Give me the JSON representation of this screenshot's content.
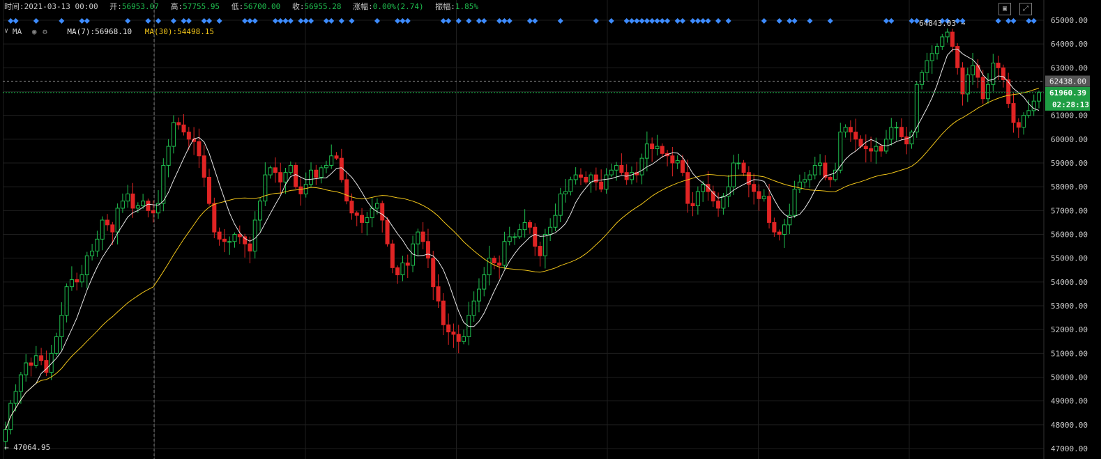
{
  "header": {
    "time_label": "时间:",
    "time_value": "2021-03-13 00:00",
    "open_label": "开:",
    "open_value": "56953.07",
    "high_label": "高:",
    "high_value": "57755.95",
    "low_label": "低:",
    "low_value": "56700.00",
    "close_label": "收:",
    "close_value": "56955.28",
    "change_label": "涨幅:",
    "change_value": "0.00%(2.74)",
    "amplitude_label": "振幅:",
    "amplitude_value": "1.85%"
  },
  "indicator": {
    "name": "MA",
    "ma7_text": "MA(7):56968.10",
    "ma30_text": "MA(30):54498.15"
  },
  "colors": {
    "up": "#1fbf4f",
    "down": "#e02424",
    "ma7": "#e6e6e6",
    "ma30": "#f0c419",
    "marker": "#3d8bfd",
    "grid": "#1e1e1e"
  },
  "icons": [
    "chevron-down-icon",
    "eye-icon",
    "gear-icon",
    "save-image-icon",
    "expand-icon"
  ],
  "chart_data": {
    "type": "candlestick",
    "y_axis_ticks": [
      "65000.00",
      "64000.00",
      "63000.00",
      "62000.00",
      "61000.00",
      "60000.00",
      "59000.00",
      "58000.00",
      "57000.00",
      "56000.00",
      "55000.00",
      "54000.00",
      "53000.00",
      "52000.00",
      "51000.00",
      "50000.00",
      "49000.00",
      "48000.00",
      "47000.00"
    ],
    "ylim": [
      46900,
      65300
    ],
    "grid": true,
    "max_label": "64843.03",
    "min_label": "47064.95",
    "current_price_label": "61960.39",
    "current_price": 61960.39,
    "dashed_price_label": "62438.00",
    "dashed_price": 62438.0,
    "countdown_label": "02:28:13",
    "closes": [
      47800,
      48900,
      49400,
      50100,
      50600,
      50500,
      50900,
      50700,
      50200,
      51000,
      51700,
      52600,
      53800,
      54100,
      54000,
      54300,
      55100,
      55300,
      55800,
      56600,
      56400,
      56100,
      57100,
      57400,
      57700,
      57100,
      57200,
      57400,
      57000,
      56900,
      57300,
      58900,
      59700,
      60700,
      60600,
      60300,
      60000,
      59900,
      59300,
      58400,
      57300,
      56100,
      55800,
      55700,
      55700,
      56000,
      55900,
      55600,
      55300,
      56600,
      57400,
      58500,
      58800,
      58600,
      58200,
      58600,
      58900,
      58000,
      57700,
      58100,
      58700,
      58400,
      58800,
      58900,
      59300,
      59200,
      58300,
      57400,
      56900,
      56800,
      56500,
      56700,
      57100,
      57300,
      56600,
      55600,
      54600,
      54300,
      54800,
      54700,
      55600,
      56100,
      55700,
      55000,
      53800,
      53200,
      52200,
      51900,
      51800,
      51500,
      51700,
      52600,
      53200,
      53700,
      54300,
      55000,
      54800,
      54700,
      55700,
      55900,
      55900,
      56200,
      56500,
      56300,
      55500,
      55100,
      56000,
      56300,
      56800,
      57700,
      57800,
      58300,
      58500,
      58400,
      58200,
      58500,
      58200,
      57900,
      58500,
      58700,
      58900,
      58600,
      58300,
      58600,
      58500,
      59200,
      59800,
      59600,
      59700,
      59400,
      59300,
      59000,
      59100,
      58600,
      57300,
      57200,
      57800,
      58100,
      57800,
      57400,
      57100,
      57600,
      58000,
      59000,
      59000,
      58600,
      58100,
      57800,
      57500,
      57600,
      56500,
      56100,
      56000,
      56400,
      56800,
      57900,
      58200,
      58300,
      58500,
      58900,
      59000,
      58400,
      58300,
      58700,
      60300,
      60500,
      60300,
      60000,
      59700,
      59600,
      59500,
      59700,
      59500,
      60000,
      60500,
      60500,
      60100,
      59800,
      60300,
      62300,
      62800,
      63300,
      63600,
      63900,
      64300,
      64500,
      63900,
      63000,
      61900,
      62700,
      63100,
      62600,
      61700,
      62300,
      63200,
      63000,
      62500,
      61500,
      60700,
      60500,
      61000,
      61200,
      61600,
      61960
    ]
  }
}
